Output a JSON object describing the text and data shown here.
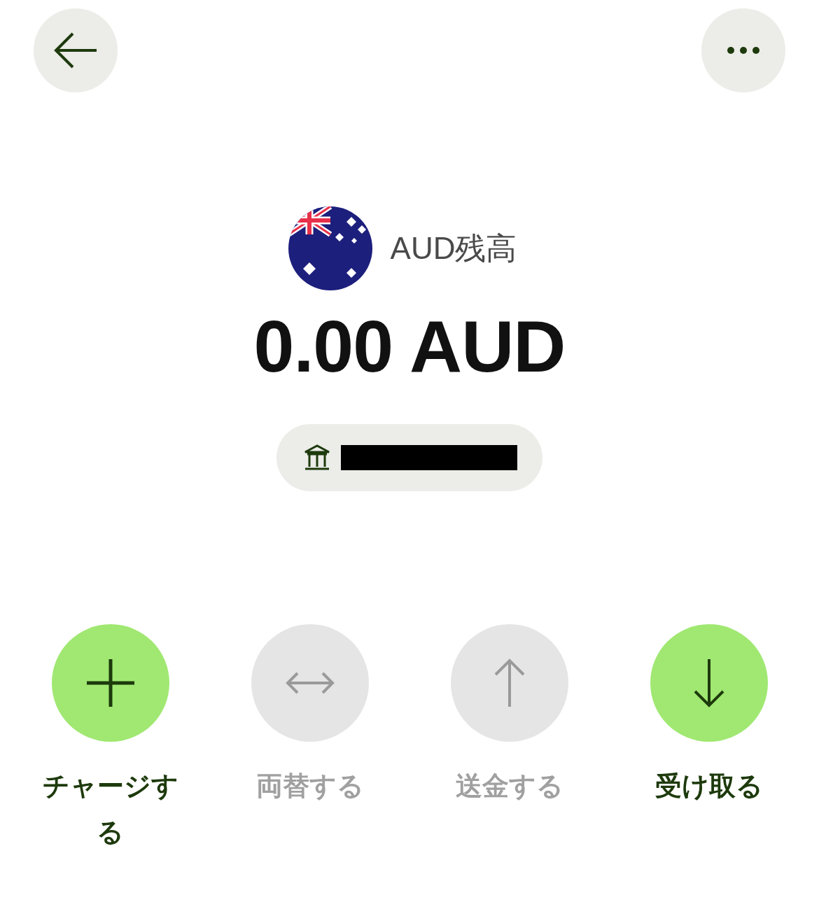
{
  "balance": {
    "label": "AUD残高",
    "amount": "0.00 AUD"
  },
  "actions": [
    {
      "kind": "plus",
      "label": "チャージする",
      "disabled": false
    },
    {
      "kind": "exchange",
      "label": "両替する",
      "disabled": true
    },
    {
      "kind": "up",
      "label": "送金する",
      "disabled": true
    },
    {
      "kind": "down",
      "label": "受け取る",
      "disabled": false
    }
  ]
}
